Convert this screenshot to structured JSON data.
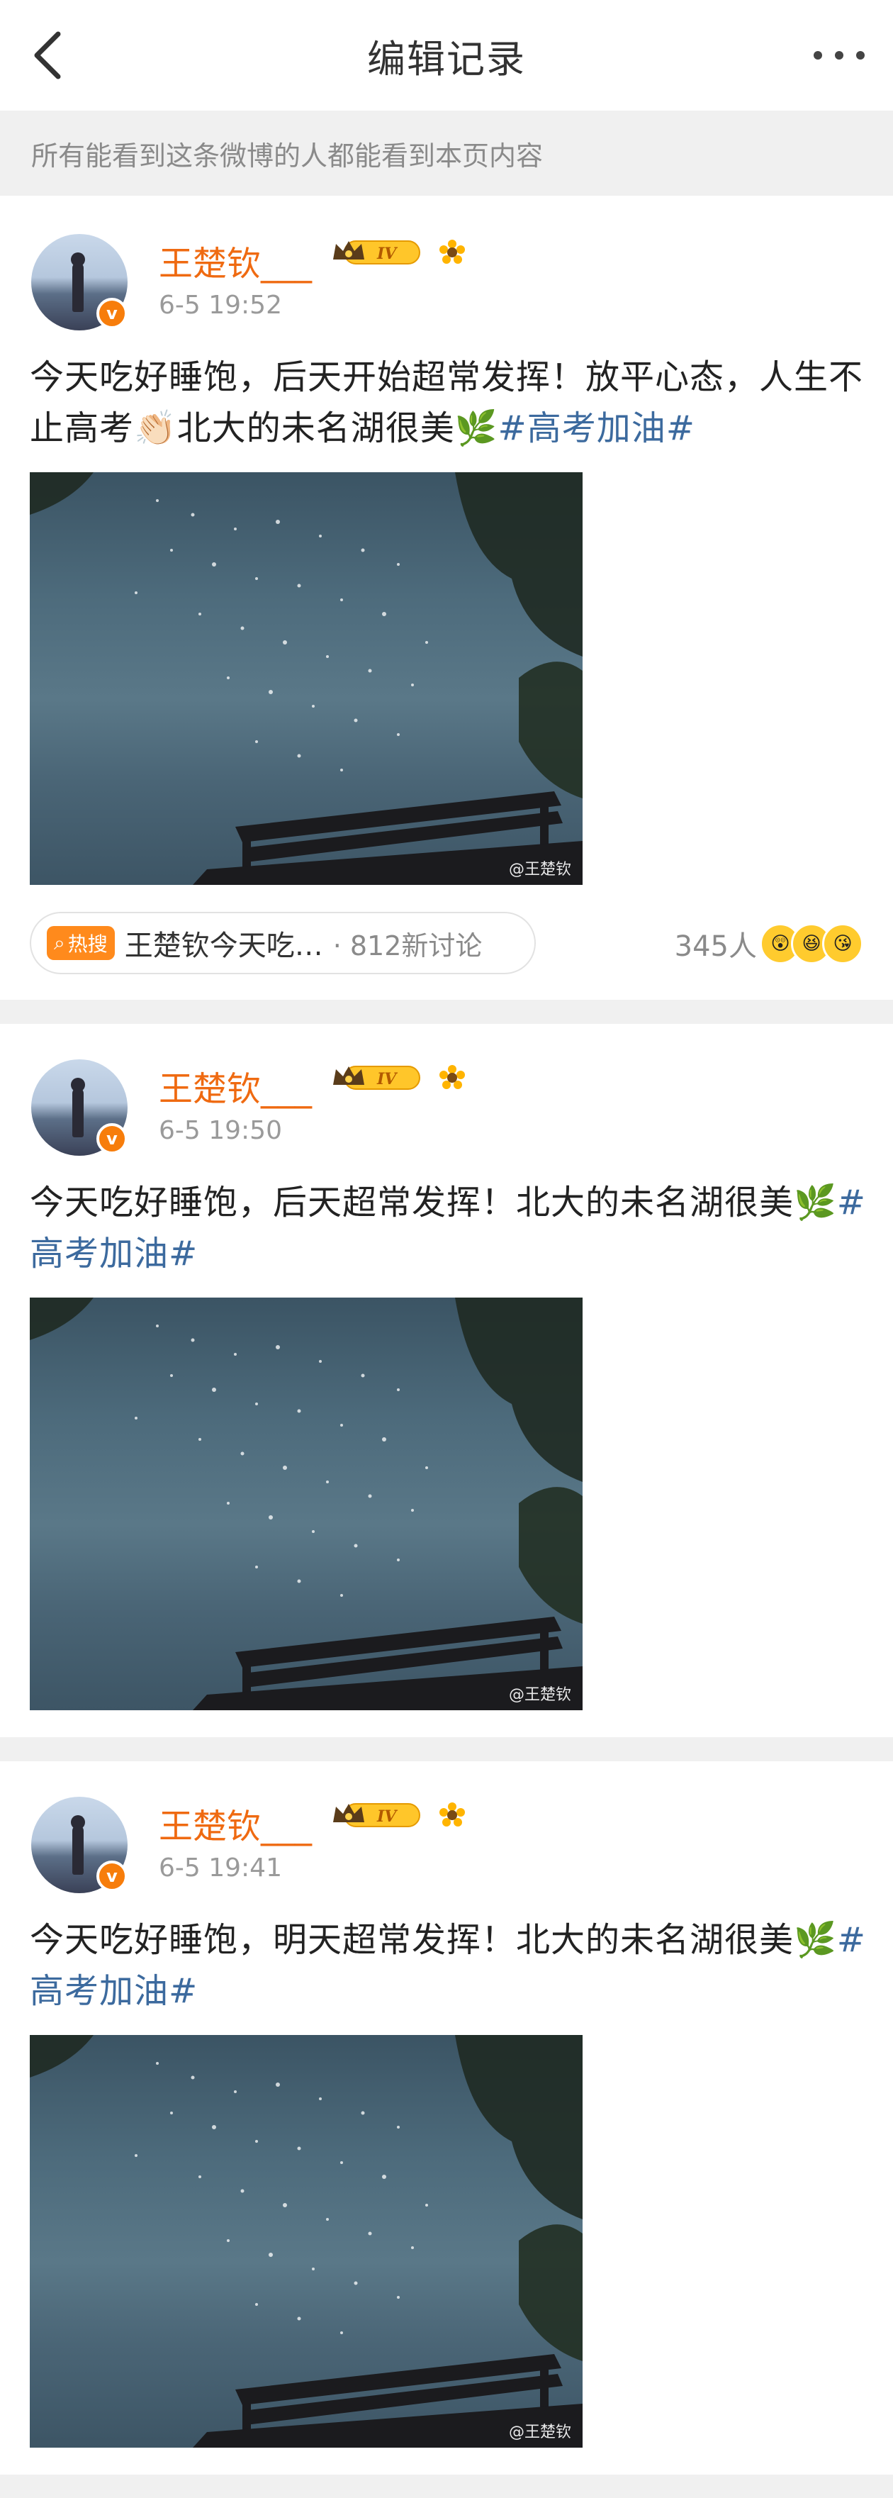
{
  "header": {
    "title": "编辑记录"
  },
  "notice": {
    "text": "所有能看到这条微博的人都能看到本页内容"
  },
  "posts": [
    {
      "username": "王楚钦___",
      "level": "IV",
      "time": "6-5 19:52",
      "text_before": "今天吃好睡饱，后天开始超常发挥！放平心态，人生不止高考👏🏻北大的未名湖很美🌿",
      "tag": "#高考加油#",
      "watermark": "@王楚钦",
      "hot": {
        "badge": "热搜",
        "title": "王楚钦今天吃…",
        "count": "· 812新讨论"
      },
      "reactions": {
        "count": "345人"
      }
    },
    {
      "username": "王楚钦___",
      "level": "IV",
      "time": "6-5 19:50",
      "text_before": "今天吃好睡饱，后天超常发挥！北大的未名湖很美🌿",
      "tag": "#高考加油#",
      "watermark": "@王楚钦"
    },
    {
      "username": "王楚钦___",
      "level": "IV",
      "time": "6-5 19:41",
      "text_before": "今天吃好睡饱，明天超常发挥！北大的未名湖很美🌿",
      "tag": "#高考加油#",
      "watermark": "@王楚钦"
    }
  ],
  "colors": {
    "username": "#ef6a11",
    "tag": "#3c6a9e",
    "badge": "#f77d0b",
    "hot": "#ff8a1c"
  }
}
